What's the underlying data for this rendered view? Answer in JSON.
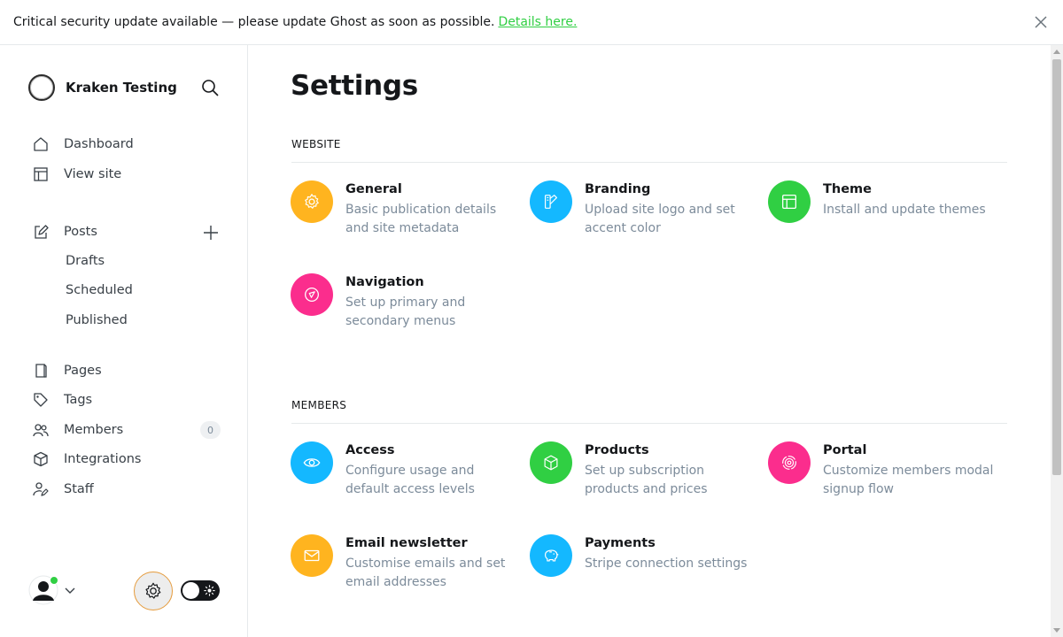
{
  "banner": {
    "message": "Critical security update available — please update Ghost as soon as possible.",
    "link_text": "Details here."
  },
  "sidebar": {
    "site_title": "Kraken Testing",
    "nav": {
      "dashboard": "Dashboard",
      "view_site": "View site",
      "posts": "Posts",
      "drafts": "Drafts",
      "scheduled": "Scheduled",
      "published": "Published",
      "pages": "Pages",
      "tags": "Tags",
      "members": "Members",
      "members_count": "0",
      "integrations": "Integrations",
      "staff": "Staff"
    }
  },
  "main": {
    "title": "Settings",
    "website_section": "WEBSITE",
    "members_section": "MEMBERS",
    "website_cards": [
      {
        "title": "General",
        "desc": "Basic publication details and site metadata",
        "icon": "gear-icon",
        "color": "#ffb41f"
      },
      {
        "title": "Branding",
        "desc": "Upload site logo and set accent color",
        "icon": "paintbrush-icon",
        "color": "#14b8ff"
      },
      {
        "title": "Theme",
        "desc": "Install and update themes",
        "icon": "layout-icon",
        "color": "#30cf43"
      },
      {
        "title": "Navigation",
        "desc": "Set up primary and secondary menus",
        "icon": "compass-icon",
        "color": "#fb2d8d"
      }
    ],
    "members_cards": [
      {
        "title": "Access",
        "desc": "Configure usage and default access levels",
        "icon": "eye-icon",
        "color": "#14b8ff"
      },
      {
        "title": "Products",
        "desc": "Set up subscription products and prices",
        "icon": "box-icon",
        "color": "#30cf43"
      },
      {
        "title": "Portal",
        "desc": "Customize members modal signup flow",
        "icon": "portal-icon",
        "color": "#fb2d8d"
      },
      {
        "title": "Email newsletter",
        "desc": "Customise emails and set email addresses",
        "icon": "envelope-icon",
        "color": "#ffb41f"
      },
      {
        "title": "Payments",
        "desc": "Stripe connection settings",
        "icon": "piggybank-icon",
        "color": "#14b8ff"
      }
    ]
  },
  "colors": {
    "accent_green": "#30cf43",
    "settings_ring": "#e59b3c"
  }
}
